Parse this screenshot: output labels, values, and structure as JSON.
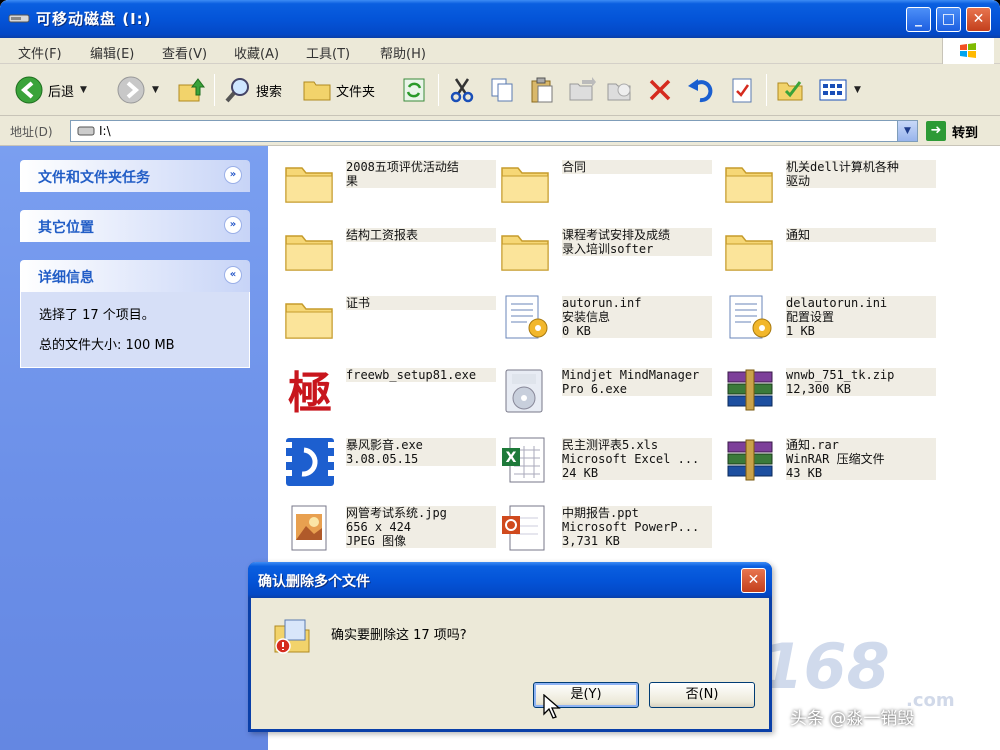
{
  "window": {
    "title": "可移动磁盘 (I:)",
    "minimize": "_",
    "maximize": "□",
    "close": "✕"
  },
  "menu": [
    "文件(F)",
    "编辑(E)",
    "查看(V)",
    "收藏(A)",
    "工具(T)",
    "帮助(H)"
  ],
  "toolbar": {
    "back": "后退",
    "search": "搜索",
    "folders": "文件夹"
  },
  "address": {
    "label": "地址(D)",
    "value": "I:\\",
    "go": "转到"
  },
  "sidebar": {
    "panels": [
      {
        "title": "文件和文件夹任务",
        "chevron": "»"
      },
      {
        "title": "其它位置",
        "chevron": "»"
      },
      {
        "title": "详细信息",
        "chevron": "«"
      }
    ],
    "details": {
      "selected": "选择了 17 个项目。",
      "size": "总的文件大小: 100 MB"
    }
  },
  "files": [
    {
      "icon": "folder-icon",
      "lines": [
        "2008五项评优活动结",
        "果"
      ]
    },
    {
      "icon": "folder-icon",
      "lines": [
        "合同"
      ]
    },
    {
      "icon": "folder-icon",
      "lines": [
        "机关dell计算机各种",
        "驱动"
      ]
    },
    {
      "icon": "folder-icon",
      "lines": [
        "结构工资报表"
      ]
    },
    {
      "icon": "folder-icon",
      "lines": [
        "课程考试安排及成绩",
        "录入培训softer"
      ]
    },
    {
      "icon": "folder-icon",
      "lines": [
        "通知"
      ]
    },
    {
      "icon": "folder-icon",
      "lines": [
        "证书"
      ]
    },
    {
      "icon": "ini-file-icon",
      "lines": [
        "autorun.inf",
        "安装信息",
        "0 KB"
      ]
    },
    {
      "icon": "ini-file-icon",
      "lines": [
        "delautorun.ini",
        "配置设置",
        "1 KB"
      ]
    },
    {
      "icon": "app-ji-icon",
      "lines": [
        "freewb_setup81.exe"
      ]
    },
    {
      "icon": "installer-icon",
      "lines": [
        "Mindjet MindManager",
        "Pro 6.exe"
      ]
    },
    {
      "icon": "winrar-icon",
      "lines": [
        "wnwb_751_tk.zip",
        "12,300 KB"
      ]
    },
    {
      "icon": "baofeng-icon",
      "lines": [
        "暴风影音.exe",
        "3.08.05.15"
      ]
    },
    {
      "icon": "excel-icon",
      "lines": [
        "民主测评表5.xls",
        "Microsoft Excel ...",
        "24 KB"
      ]
    },
    {
      "icon": "winrar-icon",
      "lines": [
        "通知.rar",
        "WinRAR 压缩文件",
        "43 KB"
      ]
    },
    {
      "icon": "jpg-icon",
      "lines": [
        "网管考试系统.jpg",
        "656 x 424",
        "JPEG 图像"
      ]
    },
    {
      "icon": "ppt-icon",
      "lines": [
        "中期报告.ppt",
        "Microsoft PowerP...",
        "3,731 KB"
      ]
    }
  ],
  "dialog": {
    "title": "确认删除多个文件",
    "close": "✕",
    "message": "确实要删除这 17 项吗?",
    "yes": "是(Y)",
    "no": "否(N)"
  },
  "watermark": {
    "brand": "IT168",
    "tld": ".com"
  },
  "byline": "头条 @淼一销毁"
}
